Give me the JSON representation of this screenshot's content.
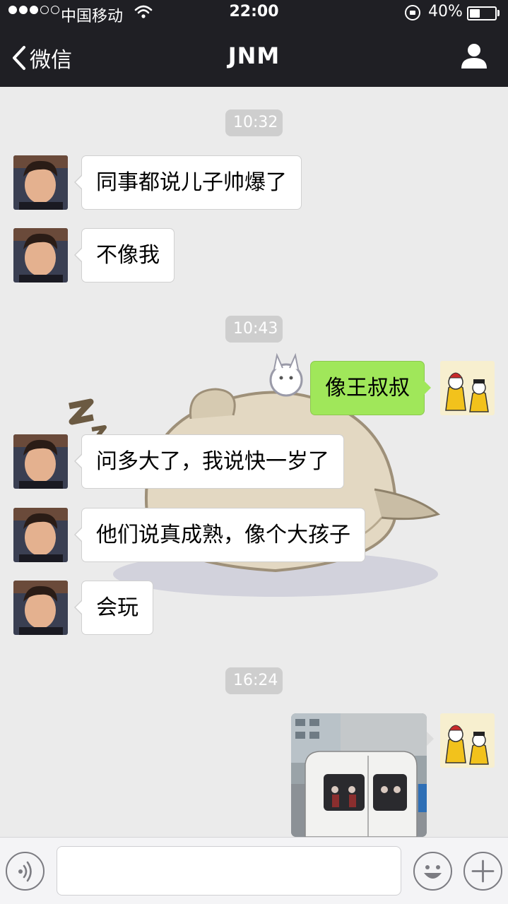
{
  "status_bar": {
    "carrier": "中国移动",
    "time": "22:00",
    "battery": "40%",
    "battery_level": 0.4,
    "signal_bars": 3,
    "signal_total": 5
  },
  "nav": {
    "back_label": "微信",
    "title": "JNM"
  },
  "messages": [
    {
      "type": "timestamp",
      "text": "10:32"
    },
    {
      "type": "incoming",
      "text": "同事都说儿子帅爆了"
    },
    {
      "type": "incoming",
      "text": "不像我"
    },
    {
      "type": "timestamp",
      "text": "10:43"
    },
    {
      "type": "outgoing",
      "text": "像王叔叔"
    },
    {
      "type": "incoming",
      "text": "问多大了，我说快一岁了"
    },
    {
      "type": "incoming",
      "text": "他们说真成熟，像个大孩子"
    },
    {
      "type": "incoming",
      "text": "会玩"
    },
    {
      "type": "timestamp",
      "text": "16:24"
    },
    {
      "type": "outgoing-image"
    }
  ],
  "input": {
    "value": "",
    "placeholder": ""
  },
  "icons": {
    "back": "chevron-left-icon",
    "profile": "person-icon",
    "voice": "voice-icon",
    "emoji": "smiley-icon",
    "plus": "plus-icon",
    "wifi": "wifi-icon",
    "rotation_lock": "rotation-lock-icon",
    "battery": "battery-icon"
  },
  "colors": {
    "header_bg": "#1f1f24",
    "chat_bg": "#ebebeb",
    "outgoing_bubble": "#a0e75a",
    "incoming_bubble": "#ffffff",
    "timestamp_bg": "#cecece"
  }
}
